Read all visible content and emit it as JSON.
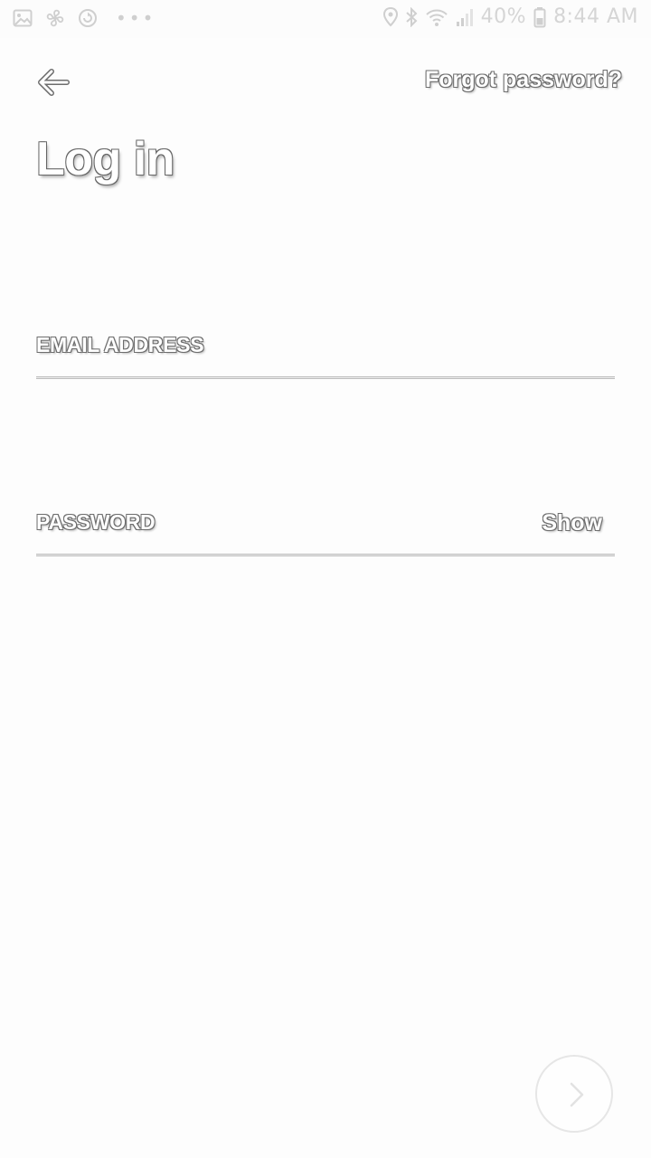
{
  "status_bar": {
    "battery_percent": "40%",
    "time": "8:44 AM",
    "more_indicator": "•••",
    "left_icons": [
      "image-icon",
      "pinwheel-icon",
      "sync-icon"
    ],
    "right_icons": [
      "location-icon",
      "bluetooth-icon",
      "wifi-icon",
      "signal-icon",
      "battery-icon"
    ]
  },
  "header": {
    "back_icon": "arrow-left-icon",
    "forgot_label": "Forgot password?"
  },
  "title": "Log in",
  "form": {
    "email": {
      "label": "EMAIL ADDRESS",
      "value": ""
    },
    "password": {
      "label": "PASSWORD",
      "value": "",
      "toggle_label": "Show"
    }
  },
  "next_button": {
    "icon": "chevron-right-icon",
    "enabled": false
  },
  "colors": {
    "background": "#fdfdfd",
    "text_fill": "#ffffff",
    "text_outline": "#6d6d6d",
    "divider": "#bdbdbd",
    "status_icons": "#d0d0d0"
  }
}
